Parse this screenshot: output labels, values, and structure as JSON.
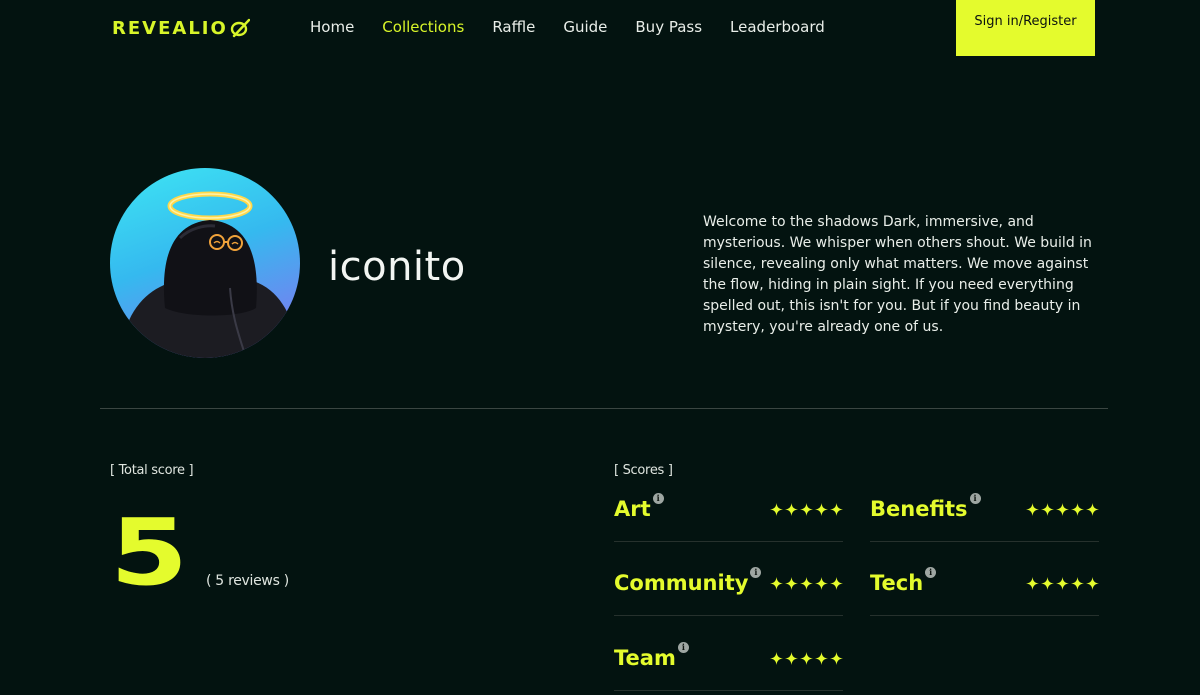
{
  "brand": {
    "logo_text": "REVEALIO",
    "accent": "#e4fb2d"
  },
  "nav": {
    "items": [
      {
        "label": "Home",
        "active": false
      },
      {
        "label": "Collections",
        "active": true
      },
      {
        "label": "Raffle",
        "active": false
      },
      {
        "label": "Guide",
        "active": false
      },
      {
        "label": "Buy Pass",
        "active": false
      },
      {
        "label": "Leaderboard",
        "active": false
      }
    ],
    "signin_label": "Sign in/Register"
  },
  "profile": {
    "username": "iconito",
    "description": "Welcome to the shadows Dark, immersive, and mysterious. We whisper when others shout. We build in silence, revealing only what matters. We move against the flow, hiding in plain sight. If you need everything spelled out, this isn't for you. But if you find beauty in mystery, you're already one of us."
  },
  "total": {
    "label": "[ Total score ]",
    "value": "5",
    "reviews": "( 5 reviews )"
  },
  "scores": {
    "label": "[ Scores ]",
    "items": [
      {
        "name": "Art",
        "rating": 5,
        "icon": "info-icon"
      },
      {
        "name": "Benefits",
        "rating": 5,
        "icon": "info-icon"
      },
      {
        "name": "Community",
        "rating": 5,
        "icon": "info-icon"
      },
      {
        "name": "Tech",
        "rating": 5,
        "icon": "info-icon"
      },
      {
        "name": "Team",
        "rating": 5,
        "icon": "info-icon"
      }
    ],
    "max_rating": 5
  }
}
